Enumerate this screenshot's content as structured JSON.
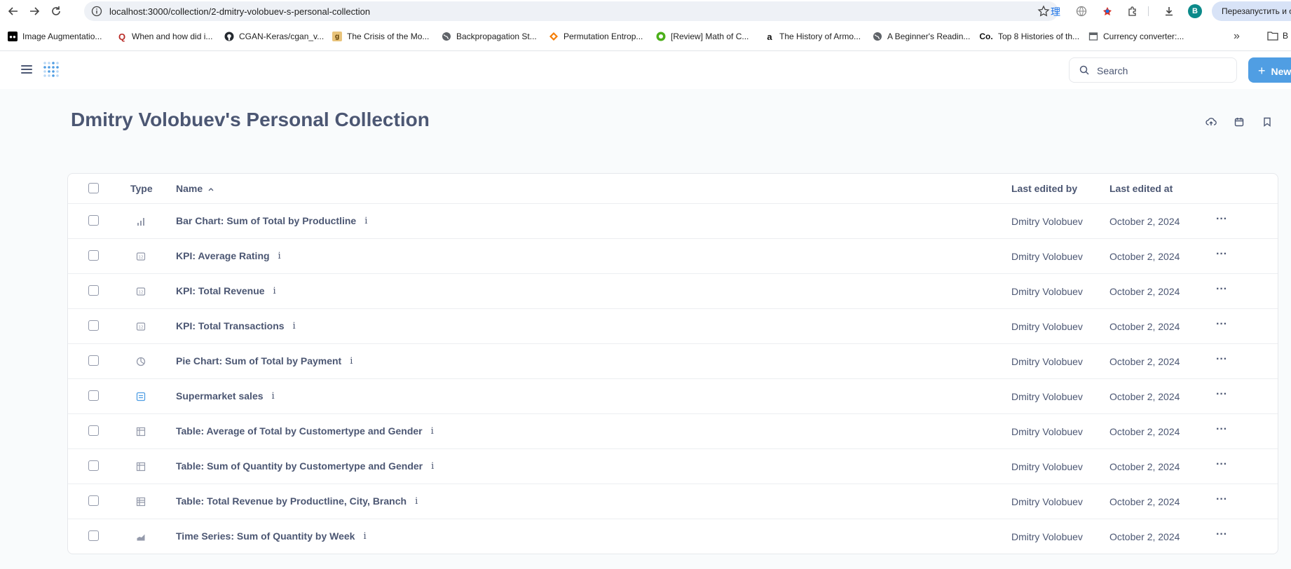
{
  "browser": {
    "url": "localhost:3000/collection/2-dmitry-volobuev-s-personal-collection",
    "profile_initial": "B",
    "restart_label": "Перезапустить и об",
    "bookmarks": [
      {
        "label": "Image Augmentatio...",
        "icon": "medium-icon"
      },
      {
        "label": "When and how did i...",
        "icon": "quora-icon"
      },
      {
        "label": "CGAN-Keras/cgan_v...",
        "icon": "github-icon"
      },
      {
        "label": "The Crisis of the Mo...",
        "icon": "g-icon"
      },
      {
        "label": "Backpropagation St...",
        "icon": "globe-icon"
      },
      {
        "label": "Permutation Entrop...",
        "icon": "diamond-icon"
      },
      {
        "label": "[Review] Math of C...",
        "icon": "review-icon"
      },
      {
        "label": "The History of Armo...",
        "icon": "amazon-icon"
      },
      {
        "label": "A Beginner's Readin...",
        "icon": "globe-icon"
      },
      {
        "label": "Top 8 Histories of th...",
        "icon": "co-icon"
      },
      {
        "label": "Currency converter:...",
        "icon": "page-icon"
      }
    ],
    "bookmarks_folder_label": "B"
  },
  "app": {
    "search_placeholder": "Search",
    "new_label": "New"
  },
  "page": {
    "title": "Dmitry Volobuev's Personal Collection"
  },
  "table": {
    "headers": {
      "type": "Type",
      "name": "Name",
      "sort_indicator": "⌃",
      "last_edited_by": "Last edited by",
      "last_edited_at": "Last edited at"
    },
    "info_glyph": "i",
    "more_glyph": "···",
    "rows": [
      {
        "type": "bar",
        "name": "Bar Chart: Sum of Total by Productline",
        "editor": "Dmitry Volobuev",
        "date": "October 2, 2024"
      },
      {
        "type": "kpi",
        "name": "KPI: Average Rating",
        "editor": "Dmitry Volobuev",
        "date": "October 2, 2024"
      },
      {
        "type": "kpi",
        "name": "KPI: Total Revenue",
        "editor": "Dmitry Volobuev",
        "date": "October 2, 2024"
      },
      {
        "type": "kpi",
        "name": "KPI: Total Transactions",
        "editor": "Dmitry Volobuev",
        "date": "October 2, 2024"
      },
      {
        "type": "pie",
        "name": "Pie Chart: Sum of Total by Payment",
        "editor": "Dmitry Volobuev",
        "date": "October 2, 2024"
      },
      {
        "type": "model",
        "name": "Supermarket sales",
        "editor": "Dmitry Volobuev",
        "date": "October 2, 2024"
      },
      {
        "type": "pivot",
        "name": "Table: Average of Total by Customertype and Gender",
        "editor": "Dmitry Volobuev",
        "date": "October 2, 2024"
      },
      {
        "type": "pivot",
        "name": "Table: Sum of Quantity by Customertype and Gender",
        "editor": "Dmitry Volobuev",
        "date": "October 2, 2024"
      },
      {
        "type": "table",
        "name": "Table: Total Revenue by Productline, City, Branch",
        "editor": "Dmitry Volobuev",
        "date": "October 2, 2024"
      },
      {
        "type": "area",
        "name": "Time Series: Sum of Quantity by Week",
        "editor": "Dmitry Volobuev",
        "date": "October 2, 2024"
      }
    ]
  },
  "colors": {
    "brand": "#509ee3",
    "text": "#4c5773",
    "background": "#f9fbfc",
    "icon_gray": "#949aab",
    "model_blue": "#509ee3"
  }
}
